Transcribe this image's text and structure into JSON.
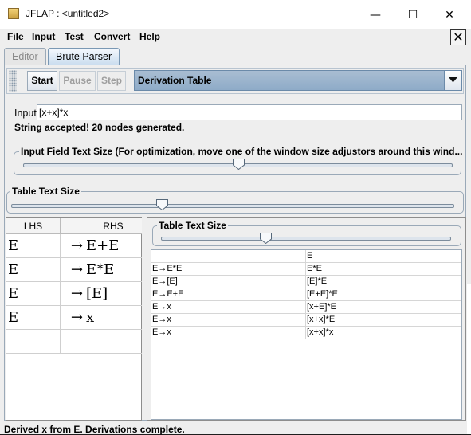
{
  "window": {
    "title": "JFLAP : <untitled2>",
    "minimize_glyph": "—",
    "maximize_glyph": "☐",
    "close_glyph": "✕"
  },
  "menu": {
    "items": [
      "File",
      "Input",
      "Test",
      "Convert",
      "Help"
    ],
    "close_inner_glyph": "✕"
  },
  "tabs": [
    {
      "label": "Editor",
      "active": false
    },
    {
      "label": "Brute Parser",
      "active": true
    }
  ],
  "toolbar": {
    "start_label": "Start",
    "pause_label": "Pause",
    "step_label": "Step",
    "view_select_value": "Derivation Table"
  },
  "input": {
    "label": "Input",
    "value": "[x+x]*x",
    "status": "String accepted!  20 nodes generated."
  },
  "input_text_size": {
    "legend": "Input Field Text Size (For optimization, move one of the window size adjustors around this wind...",
    "level": 0.5
  },
  "table_text_size": {
    "legend": "Table Text Size",
    "level": 0.34
  },
  "grammar": {
    "headers": [
      "LHS",
      "",
      "RHS"
    ],
    "arrow": "→",
    "rows": [
      {
        "lhs": "E",
        "rhs": "E+E"
      },
      {
        "lhs": "E",
        "rhs": "E*E"
      },
      {
        "lhs": "E",
        "rhs": "[E]"
      },
      {
        "lhs": "E",
        "rhs": "x"
      }
    ]
  },
  "derivation": {
    "legend": "Table Text Size",
    "level": 0.36,
    "header_right": "E",
    "rows": [
      {
        "production": "E→E*E",
        "derivation": "E*E"
      },
      {
        "production": "E→[E]",
        "derivation": "[E]*E"
      },
      {
        "production": "E→E+E",
        "derivation": "[E+E]*E"
      },
      {
        "production": "E→x",
        "derivation": "[x+E]*E"
      },
      {
        "production": "E→x",
        "derivation": "[x+x]*E"
      },
      {
        "production": "E→x",
        "derivation": "[x+x]*x"
      }
    ]
  },
  "status_bar": "Derived x from E.  Derivations complete."
}
